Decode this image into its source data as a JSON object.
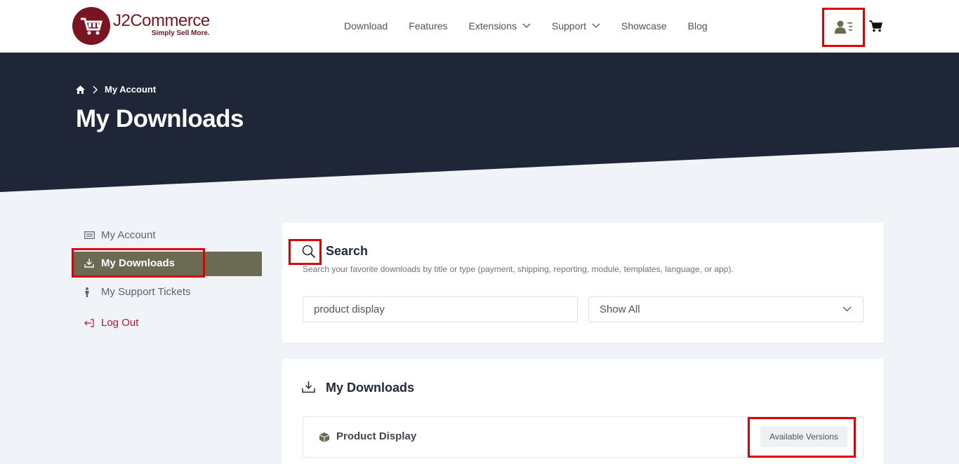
{
  "brand": {
    "name": "J2Commerce",
    "tagline": "Simply Sell More.",
    "color": "#7a1420"
  },
  "nav": {
    "items": [
      {
        "label": "Download",
        "dropdown": false
      },
      {
        "label": "Features",
        "dropdown": false
      },
      {
        "label": "Extensions",
        "dropdown": true
      },
      {
        "label": "Support",
        "dropdown": true
      },
      {
        "label": "Showcase",
        "dropdown": false
      },
      {
        "label": "Blog",
        "dropdown": false
      }
    ],
    "icons": [
      "account-icon",
      "cart-icon"
    ]
  },
  "breadcrumb": {
    "home_icon": "home-icon",
    "current": "My Account"
  },
  "page_title": "My Downloads",
  "sidebar": {
    "items": [
      {
        "label": "My Account",
        "icon": "id-card-icon",
        "active": false
      },
      {
        "label": "My Downloads",
        "icon": "download-icon",
        "active": true
      },
      {
        "label": "My Support Tickets",
        "icon": "person-icon",
        "active": false
      },
      {
        "label": "Log Out",
        "icon": "logout-icon",
        "active": false
      }
    ]
  },
  "search": {
    "title": "Search",
    "description": "Search your favorite downloads by title or type (payment, shipping, reporting, module, templates, language, or app).",
    "input_value": "product display",
    "filter_value": "Show All"
  },
  "downloads": {
    "title": "My Downloads",
    "items": [
      {
        "label": "Product Display",
        "action": "Available Versions"
      }
    ]
  },
  "colors": {
    "hero": "#1e2638",
    "accent_active": "#6b6a52",
    "logout": "#c8102e",
    "highlight": "#e00000"
  }
}
